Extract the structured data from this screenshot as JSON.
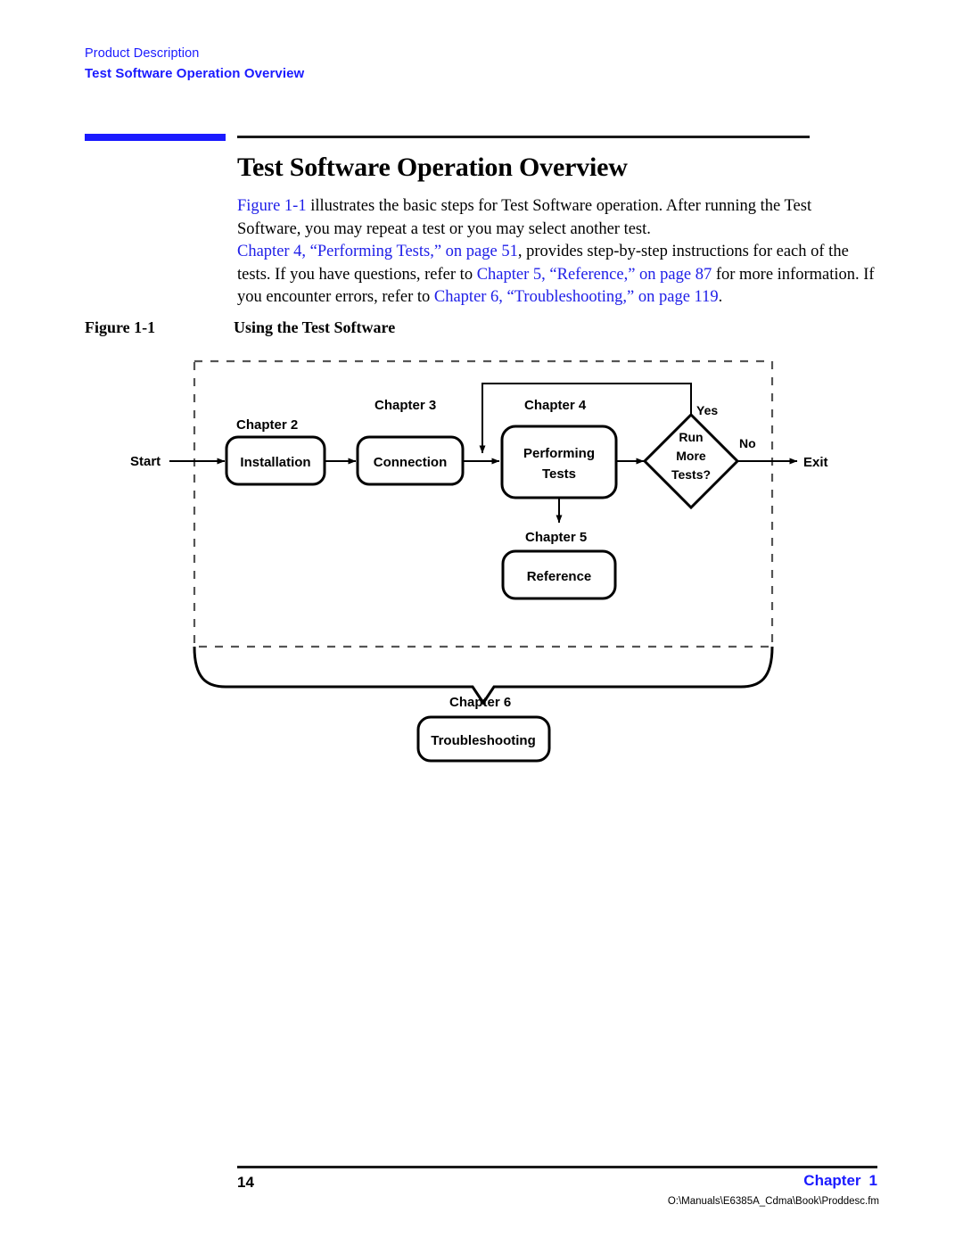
{
  "header": {
    "section": "Product Description",
    "topic": "Test Software Operation Overview",
    "accent_color": "#1a1aff"
  },
  "title": "Test Software Operation Overview",
  "paragraphs": {
    "p1_xref": "Figure 1-1",
    "p1_rest": " illustrates the basic steps for Test Software operation. After running the Test Software, you may repeat a test or you may select another test.",
    "p2_xref1": "Chapter 4, “Performing Tests,” on page 51",
    "p2_t1": ", provides step-by-step instructions for each of the tests. If you have questions, refer to ",
    "p2_xref2": "Chapter 5, “Reference,” on page 87",
    "p2_t2": " for more information. If you encounter errors, refer to ",
    "p2_xref3": "Chapter 6, “Troubleshooting,” on page 119",
    "p2_t3": "."
  },
  "figure": {
    "number": "Figure 1-1",
    "caption": "Using the Test Software",
    "flow": {
      "start": "Start",
      "exit": "Exit",
      "yes": "Yes",
      "no": "No",
      "nodes": [
        {
          "chapter": "Chapter 2",
          "label": "Installation"
        },
        {
          "chapter": "Chapter 3",
          "label": "Connection"
        },
        {
          "chapter": "Chapter 4",
          "label_line1": "Performing",
          "label_line2": "Tests"
        },
        {
          "chapter": "Chapter 5",
          "label": "Reference"
        },
        {
          "chapter": "Chapter 6",
          "label": "Troubleshooting"
        }
      ],
      "decision": {
        "line1": "Run",
        "line2": "More",
        "line3": "Tests?"
      }
    }
  },
  "footer": {
    "page_number": "14",
    "chapter_word": "Chapter",
    "chapter_number": "1",
    "file_path": "O:\\Manuals\\E6385A_Cdma\\Book\\Proddesc.fm",
    "accent_color": "#1a1aff"
  }
}
